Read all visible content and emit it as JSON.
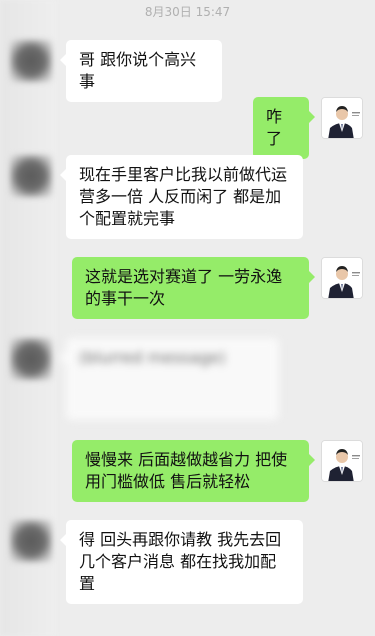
{
  "chat": {
    "timestamp": "8月30日 15:47",
    "messages": [
      {
        "side": "in",
        "text": "哥 跟你说个高兴事"
      },
      {
        "side": "out",
        "text": "咋了"
      },
      {
        "side": "in",
        "text": "现在手里客户比我以前做代运营多一倍 人反而闲了 都是加个配置就完事"
      },
      {
        "side": "out",
        "text": "这就是选对赛道了 一劳永逸的事干一次"
      },
      {
        "side": "in",
        "text": "(blurred message)",
        "blurred": true
      },
      {
        "side": "out",
        "text": "慢慢来 后面越做越省力 把使用门槛做低 售后就轻松"
      },
      {
        "side": "in",
        "text": "得 回头再跟你请教 我先去回几个客户消息 都在找我加配置"
      }
    ]
  },
  "colors": {
    "background": "#ededed",
    "incoming_bubble": "#ffffff",
    "outgoing_bubble": "#95ec69",
    "timestamp_text": "#b0b0b0"
  },
  "icons": {
    "incoming_avatar": "blurred-avatar",
    "outgoing_avatar": "business-person-avatar"
  }
}
